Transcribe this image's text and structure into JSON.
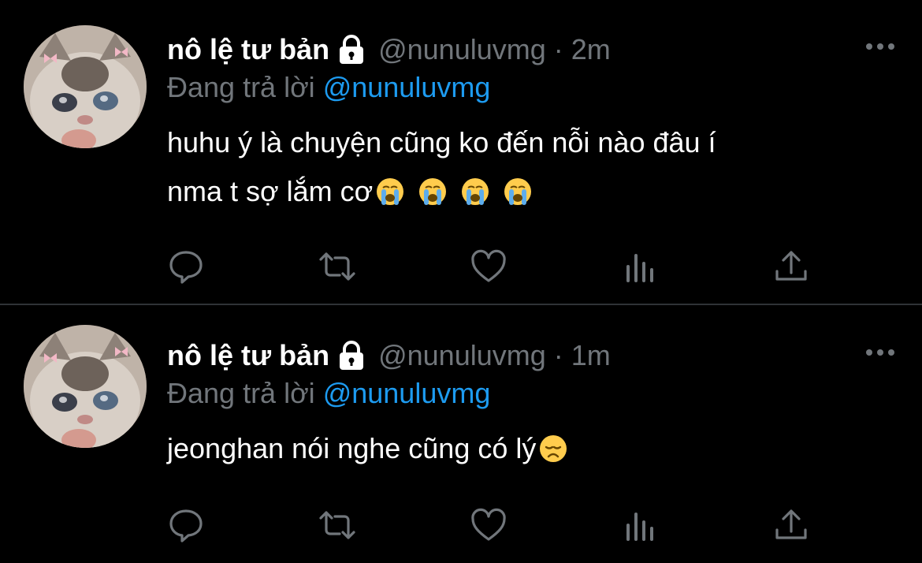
{
  "tweets": [
    {
      "name": "nô lệ tư bản",
      "handle": "@nunuluvmg",
      "separator": "·",
      "time": "2m",
      "replying_prefix": "Đang trả lời ",
      "replying_to": "@nunuluvmg",
      "lines": [
        "huhu ý là chuyện cũng ko đến nỗi nào đâu í",
        "nma t sợ lắm cơ"
      ],
      "emojis": [
        "loudly-crying-face",
        "loudly-crying-face",
        "loudly-crying-face",
        "loudly-crying-face"
      ]
    },
    {
      "name": "nô lệ tư bản",
      "handle": "@nunuluvmg",
      "separator": "·",
      "time": "1m",
      "replying_prefix": "Đang trả lời ",
      "replying_to": "@nunuluvmg",
      "lines": [
        "jeonghan nói nghe cũng có lý"
      ],
      "emojis": [
        "disappointed-face"
      ]
    }
  ],
  "icons": {
    "actions": [
      "reply-icon",
      "retweet-icon",
      "like-icon",
      "analytics-icon",
      "share-icon"
    ],
    "more": "more-icon",
    "lock": "lock-icon"
  },
  "colors": {
    "background": "#000000",
    "primary_text": "#ffffff",
    "secondary_text": "#71767b",
    "mention": "#1d9bf0",
    "divider": "#2f3336"
  }
}
